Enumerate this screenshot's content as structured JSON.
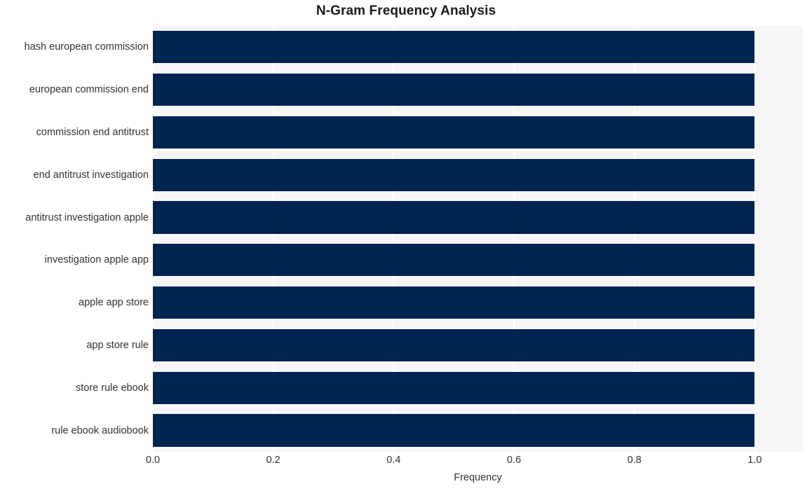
{
  "chart_data": {
    "type": "bar",
    "orientation": "horizontal",
    "title": "N-Gram Frequency Analysis",
    "xlabel": "Frequency",
    "ylabel": "",
    "categories": [
      "hash european commission",
      "european commission end",
      "commission end antitrust",
      "end antitrust investigation",
      "antitrust investigation apple",
      "investigation apple app",
      "apple app store",
      "app store rule",
      "store rule ebook",
      "rule ebook audiobook"
    ],
    "values": [
      1.0,
      1.0,
      1.0,
      1.0,
      1.0,
      1.0,
      1.0,
      1.0,
      1.0,
      1.0
    ],
    "xlim": [
      0.0,
      1.08
    ],
    "xticks": [
      0.0,
      0.2,
      0.4,
      0.6,
      0.8,
      1.0
    ],
    "xtick_labels": [
      "0.0",
      "0.2",
      "0.4",
      "0.6",
      "0.8",
      "1.0"
    ],
    "grid": true,
    "grid_axis": "x",
    "legend": null,
    "bar_color": "#002450",
    "plot_background": "#f6f6f6",
    "grid_color": "#ffffff",
    "figure_background": "#ffffff",
    "text_color": "#333333",
    "title_color": "#1a1a1a"
  }
}
